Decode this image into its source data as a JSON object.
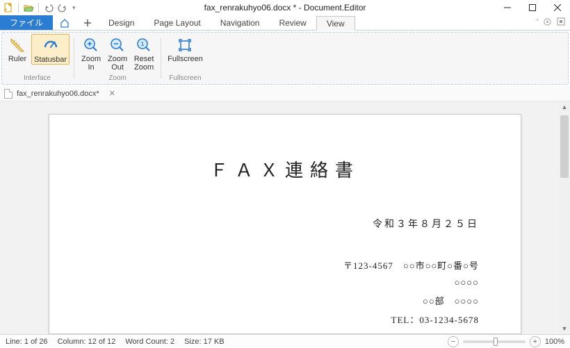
{
  "title": "fax_renrakuhyo06.docx * - Document.Editor",
  "tabs": {
    "file": "ファイル",
    "design": "Design",
    "page_layout": "Page Layout",
    "navigation": "Navigation",
    "review": "Review",
    "view": "View"
  },
  "ribbon": {
    "groups": {
      "interface": {
        "label": "Interface",
        "ruler": "Ruler",
        "statusbar": "Statusbar"
      },
      "zoom": {
        "label": "Zoom",
        "zoom_in": "Zoom\nIn",
        "zoom_out": "Zoom\nOut",
        "reset": "Reset\nZoom"
      },
      "fullscreen": {
        "label": "Fullscreen",
        "btn": "Fullscreen"
      }
    }
  },
  "doctab": {
    "name": "fax_renrakuhyo06.docx*"
  },
  "document": {
    "title": "ＦＡＸ連絡書",
    "date": "令和３年８月２５日",
    "addr": "〒123-4567　○○市○○町○番○号",
    "company": "○○○○",
    "dept": "○○部　○○○○",
    "tel": "TEL：03-1234-5678"
  },
  "status": {
    "line": "Line: 1 of 26",
    "column": "Column: 12 of 12",
    "words": "Word Count: 2",
    "size": "Size: 17 KB",
    "zoom": "100%"
  }
}
